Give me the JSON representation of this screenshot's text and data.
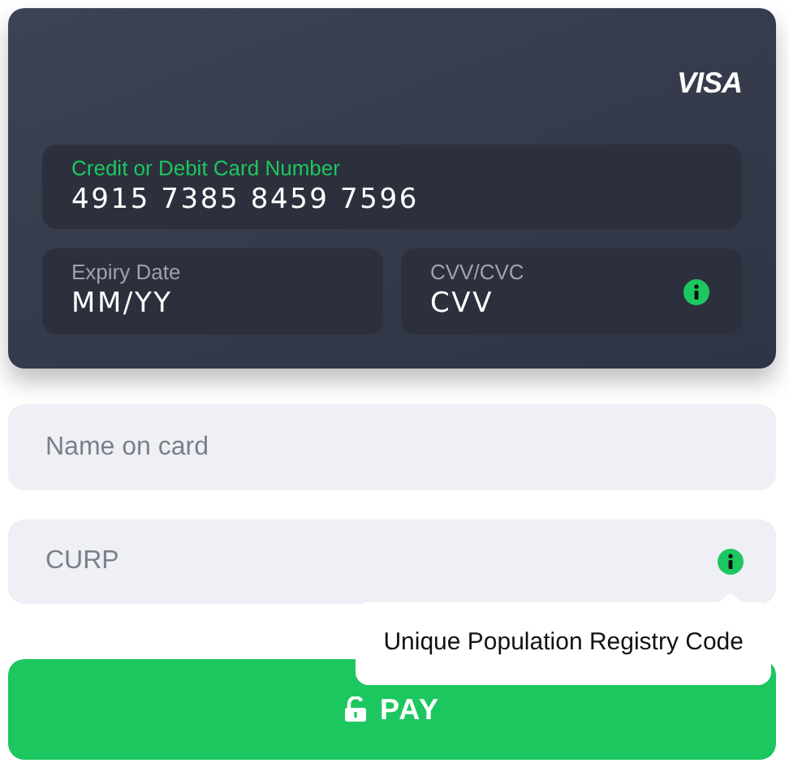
{
  "card": {
    "brand": "VISA",
    "number_field": {
      "label": "Credit or Debit Card Number",
      "value": "4915 7385 8459 7596",
      "focused": true
    },
    "fields": [
      {
        "label": "Expiry Date",
        "placeholder": "MM/YY",
        "info": false
      },
      {
        "label": "CVV/CVC",
        "placeholder": "CVV",
        "info": true
      }
    ]
  },
  "form_fields": [
    {
      "placeholder": "Name on card",
      "info": false
    },
    {
      "placeholder": "CURP",
      "info": true
    }
  ],
  "tooltip": {
    "text": "Unique Population Registry Code"
  },
  "pay_button": {
    "label": "PAY"
  }
}
